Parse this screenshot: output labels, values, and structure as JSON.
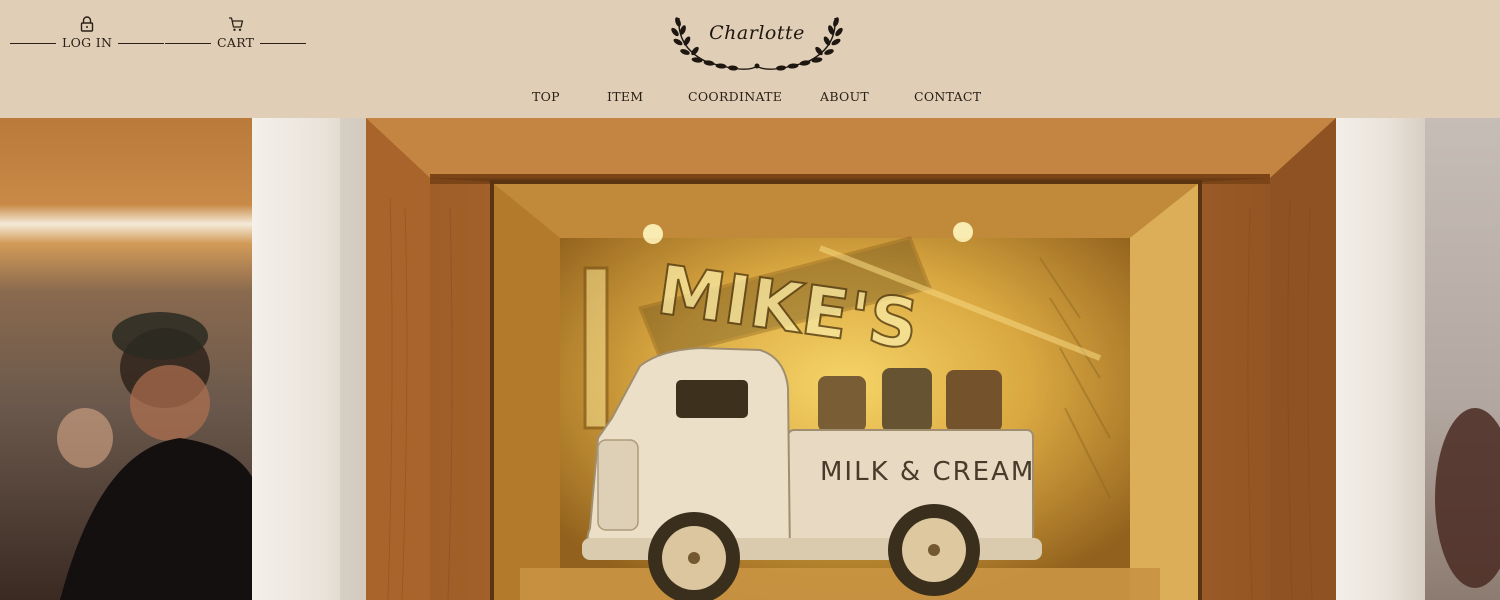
{
  "utility": {
    "login": {
      "label": "LOG IN",
      "icon": "lock-icon"
    },
    "cart": {
      "label": "CART",
      "icon": "cart-icon"
    }
  },
  "logo": {
    "text": "Charlotte"
  },
  "nav": [
    {
      "label": "TOP"
    },
    {
      "label": "ITEM"
    },
    {
      "label": "COORDINATE"
    },
    {
      "label": "ABOUT"
    },
    {
      "label": "CONTACT"
    }
  ],
  "hero": {
    "truck_label": "MILK & CREAM",
    "sign_text": "MIKE'S"
  },
  "colors": {
    "header_bg": "#e0cfb6",
    "text": "#2a2018",
    "frame_wood": "#a8642a",
    "wall_plaster": "#efebe4",
    "glow": "#f2c84a"
  }
}
